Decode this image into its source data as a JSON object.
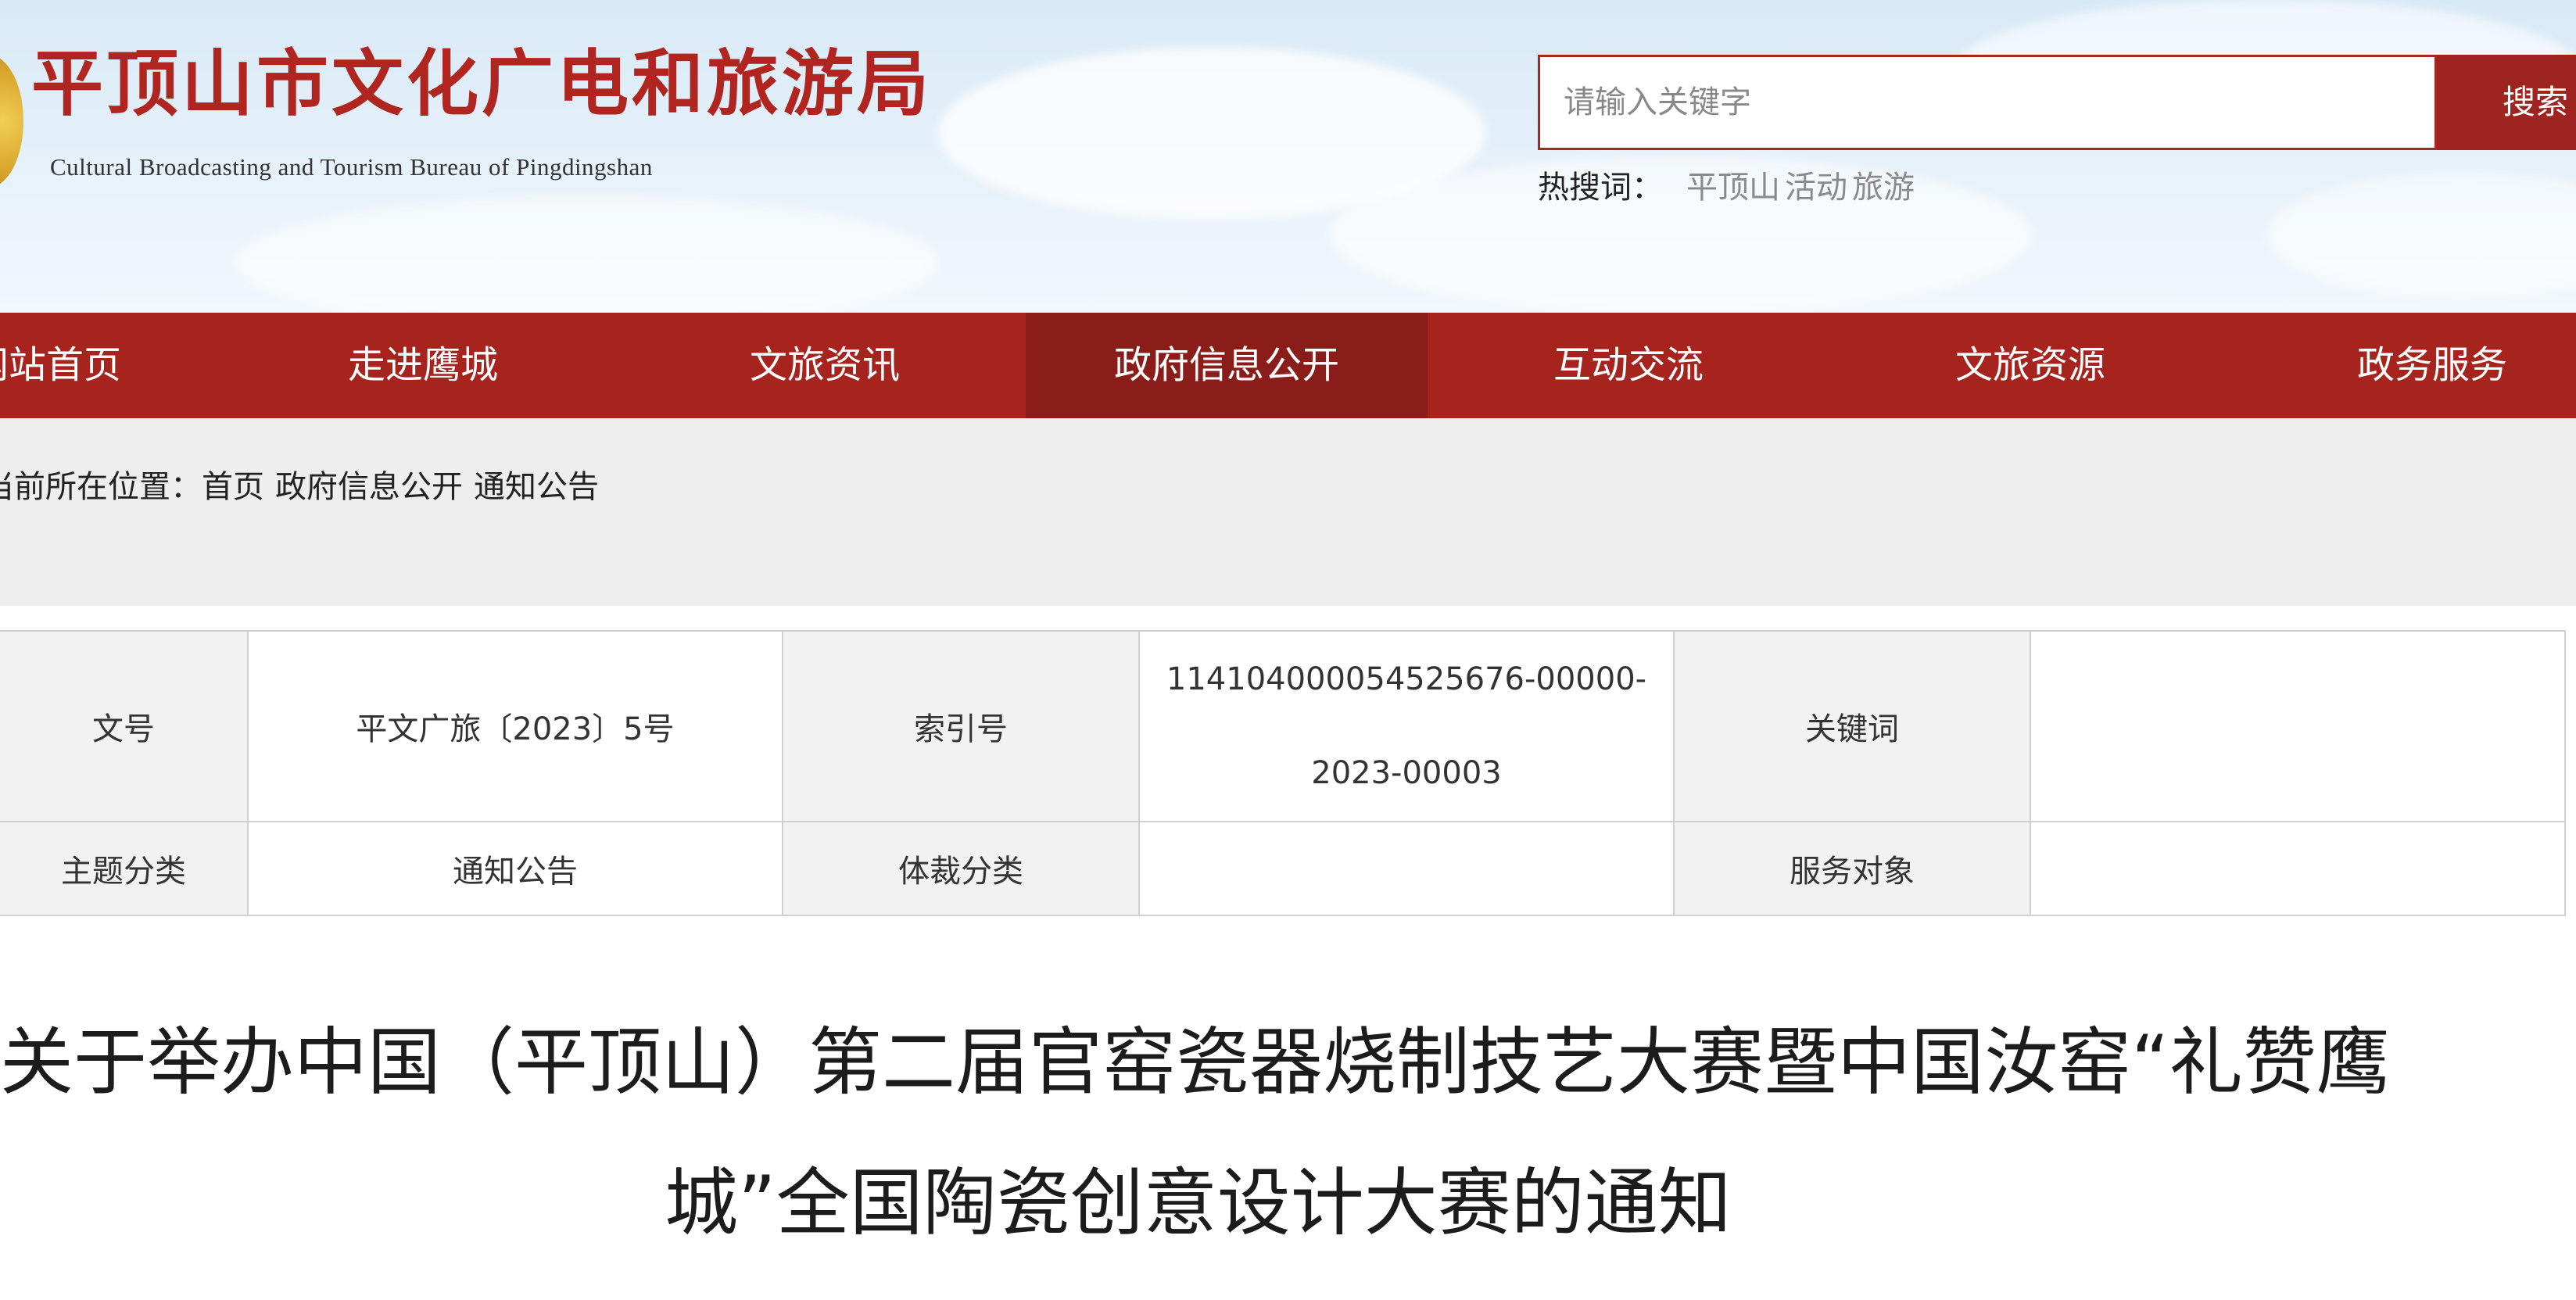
{
  "header": {
    "logo_cn": "平顶山市文化广电和旅游局",
    "logo_en": "Cultural Broadcasting and Tourism Bureau of Pingdingshan",
    "search": {
      "placeholder": "请输入关键字",
      "button": "搜索"
    },
    "hot": {
      "label": "热搜词：",
      "words": [
        "平顶山",
        "活动",
        "旅游"
      ]
    }
  },
  "nav": {
    "items": [
      "网站首页",
      "走进鹰城",
      "文旅资讯",
      "政府信息公开",
      "互动交流",
      "文旅资源",
      "政务服务"
    ],
    "active": "政府信息公开"
  },
  "breadcrumb": {
    "label": "当前所在位置：",
    "items": [
      "首页",
      "政府信息公开",
      "通知公告"
    ]
  },
  "meta": {
    "doc_no_label": "文号",
    "doc_no": "平文广旅〔2023〕5号",
    "index_label": "索引号",
    "index_line1": "114104000054525676-00000-",
    "index_line2": "2023-00003",
    "keyword_label": "关键词",
    "keyword": "",
    "topic_label": "主题分类",
    "topic": "通知公告",
    "genre_label": "体裁分类",
    "genre": "",
    "audience_label": "服务对象",
    "audience": ""
  },
  "article": {
    "title_line1": "关于举办中国（平顶山）第二届官窑瓷器烧制技艺大赛暨中国汝窑“礼赞鹰",
    "title_line2": "城”全国陶瓷创意设计大赛的通知"
  },
  "colors": {
    "brand_red": "#a6231e",
    "nav_active": "#8a1d19",
    "hot_word": "#8a8a8a"
  }
}
